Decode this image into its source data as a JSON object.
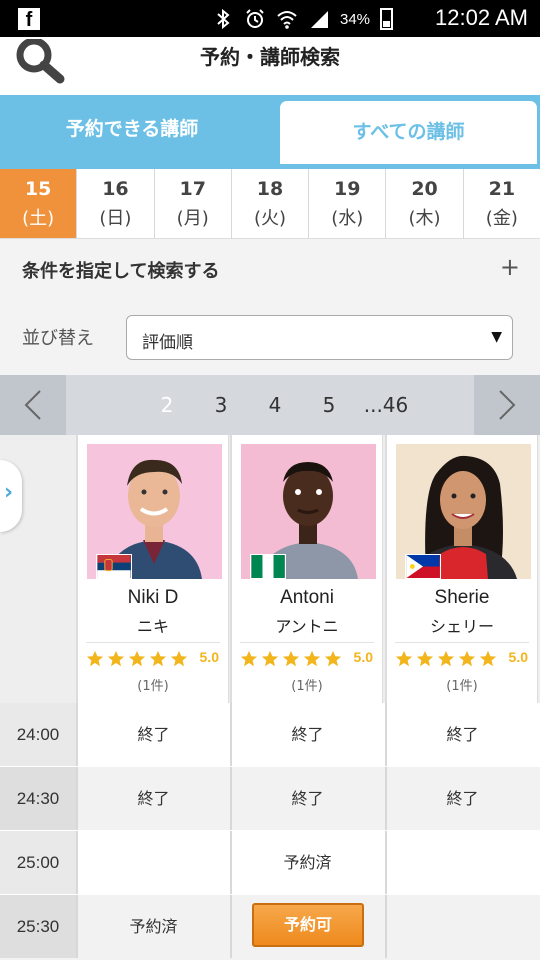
{
  "status_bar": {
    "app_icon": "facebook-icon",
    "icons": [
      "bluetooth-icon",
      "alarm-icon",
      "wifi-icon",
      "signal-icon"
    ],
    "battery": "34%",
    "time": "12:02 AM"
  },
  "header": {
    "title": "予約・講師検索",
    "search_icon": "search-icon"
  },
  "tabs": {
    "available": "予約できる講師",
    "all": "すべての講師"
  },
  "dates": [
    {
      "num": "15",
      "dow": "(土)"
    },
    {
      "num": "16",
      "dow": "(日)"
    },
    {
      "num": "17",
      "dow": "(月)"
    },
    {
      "num": "18",
      "dow": "(火)"
    },
    {
      "num": "19",
      "dow": "(水)"
    },
    {
      "num": "20",
      "dow": "(木)"
    },
    {
      "num": "21",
      "dow": "(金)"
    }
  ],
  "filter": {
    "label": "条件を指定して検索する",
    "expand": "+"
  },
  "sort": {
    "label": "並び替え",
    "selected": "評価順",
    "arrow": "▼"
  },
  "pager": {
    "pages": [
      "2",
      "3",
      "4",
      "5",
      "...46"
    ],
    "current": "2"
  },
  "teachers": [
    {
      "name": "Niki D",
      "kana": "ニキ",
      "rating": "5.0",
      "reviews": "(1件)",
      "stars": 5,
      "flag": "serbia-flag",
      "bg": "#f6c4dc"
    },
    {
      "name": "Antoni",
      "kana": "アントニ",
      "rating": "5.0",
      "reviews": "(1件)",
      "stars": 5,
      "flag": "nigeria-flag",
      "bg": "#f3bcd2"
    },
    {
      "name": "Sherie",
      "kana": "シェリー",
      "rating": "5.0",
      "reviews": "(1件)",
      "stars": 5,
      "flag": "philippines-flag",
      "bg": "#f1e3ce"
    }
  ],
  "schedule": [
    {
      "time": "24:00",
      "cells": [
        "終了",
        "終了",
        "終了"
      ]
    },
    {
      "time": "24:30",
      "cells": [
        "終了",
        "終了",
        "終了"
      ]
    },
    {
      "time": "25:00",
      "cells": [
        "",
        "予約済",
        ""
      ]
    },
    {
      "time": "25:30",
      "cells": [
        "予約済",
        "予約可",
        ""
      ]
    }
  ],
  "colors": {
    "accent_blue": "#6cc0e6",
    "active_date": "#f0923b",
    "star": "#f2b51b",
    "book_button": "#ee8a1e"
  }
}
